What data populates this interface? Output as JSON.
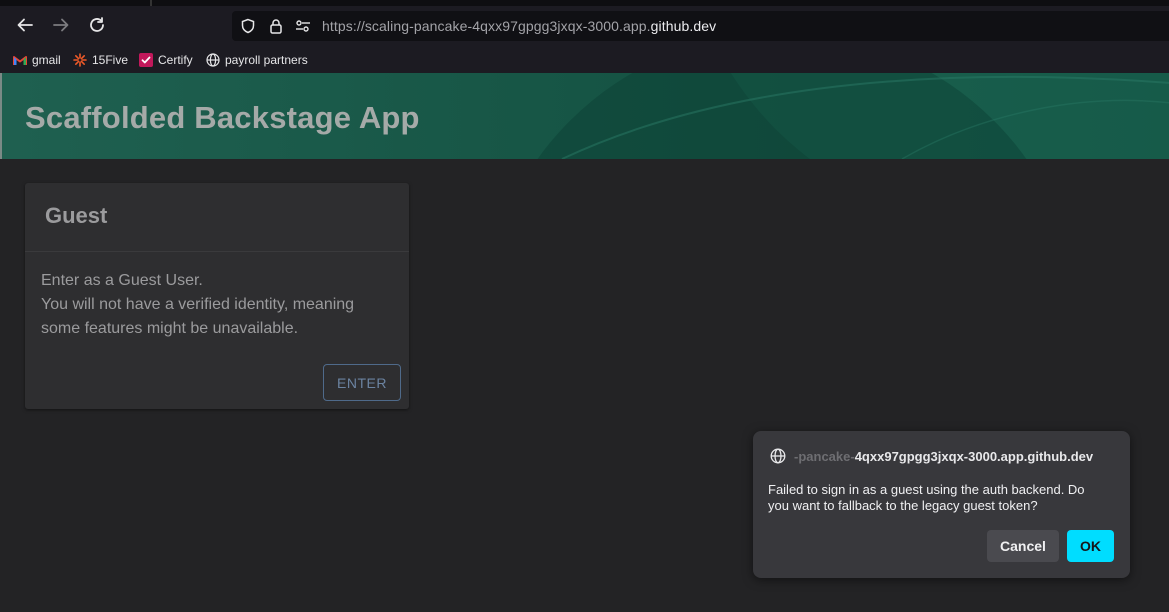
{
  "browser": {
    "url_prefix": "https://scaling-pancake-4qxx97gpgg3jxqx-3000.app.",
    "url_host": "github.dev",
    "bookmarks": [
      {
        "label": "gmail",
        "icon": "gmail-icon"
      },
      {
        "label": "15Five",
        "icon": "15five-icon"
      },
      {
        "label": "Certify",
        "icon": "certify-check-icon"
      },
      {
        "label": "payroll partners",
        "icon": "globe-icon"
      }
    ]
  },
  "app": {
    "title": "Scaffolded Backstage App"
  },
  "guest_card": {
    "title": "Guest",
    "lines": [
      "Enter as a Guest User.",
      "You will not have a verified identity, meaning",
      "some features might be unavailable."
    ],
    "enter_label": "ENTER"
  },
  "dialog": {
    "origin_faded": "-pancake-",
    "origin_main": "4qxx97gpgg3jxqx-3000.app.github.dev",
    "message_lines": [
      "Failed to sign in as a guest using the auth backend. Do",
      "you want to fallback to the legacy guest token?"
    ],
    "cancel_label": "Cancel",
    "ok_label": "OK"
  },
  "colors": {
    "accent_ok": "#00ddff",
    "header_green": "#175646",
    "page_bg": "#232325"
  }
}
